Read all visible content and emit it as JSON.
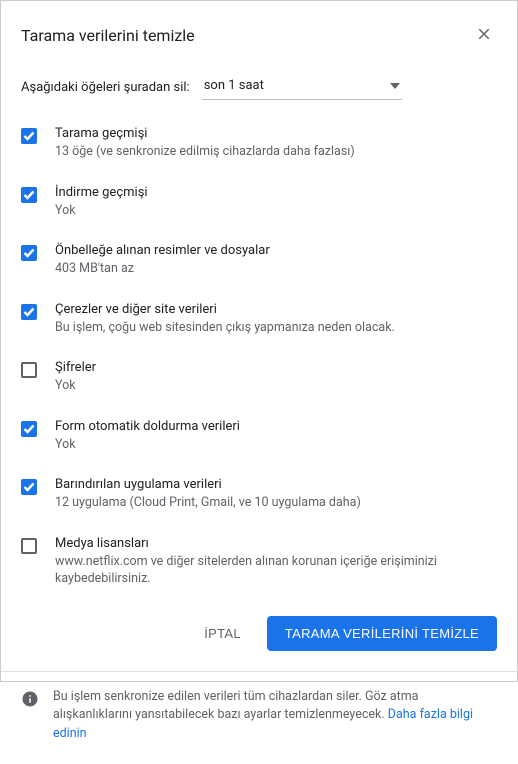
{
  "dialog": {
    "title": "Tarama verilerini temizle",
    "range_label": "Aşağıdaki öğeleri şuradan sil:",
    "range_value": "son 1 saat"
  },
  "options": [
    {
      "checked": true,
      "title": "Tarama geçmişi",
      "desc": "13 öğe (ve senkronize edilmiş cihazlarda daha fazlası)"
    },
    {
      "checked": true,
      "title": "İndirme geçmişi",
      "desc": "Yok"
    },
    {
      "checked": true,
      "title": "Önbelleğe alınan resimler ve dosyalar",
      "desc": "403 MB'tan az"
    },
    {
      "checked": true,
      "title": "Çerezler ve diğer site verileri",
      "desc": "Bu işlem, çoğu web sitesinden çıkış yapmanıza neden olacak."
    },
    {
      "checked": false,
      "title": "Şifreler",
      "desc": "Yok"
    },
    {
      "checked": true,
      "title": "Form otomatik doldurma verileri",
      "desc": "Yok"
    },
    {
      "checked": true,
      "title": "Barındırılan uygulama verileri",
      "desc": "12 uygulama (Cloud Print, Gmail, ve 10 uygulama daha)"
    },
    {
      "checked": false,
      "title": "Medya lisansları",
      "desc": "www.netflix.com ve diğer sitelerden alınan korunan içeriğe erişiminizi kaybedebilirsiniz."
    }
  ],
  "actions": {
    "cancel": "İPTAL",
    "confirm": "TARAMA VERİLERİNİ TEMİZLE"
  },
  "footer": {
    "text": "Bu işlem senkronize edilen verileri tüm cihazlardan siler. Göz atma alışkanlıklarını yansıtabilecek bazı ayarlar temizlenmeyecek.  ",
    "link": "Daha fazla bilgi edinin"
  }
}
